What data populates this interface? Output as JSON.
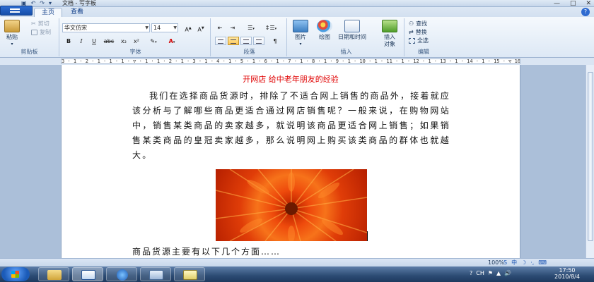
{
  "title_bar": {
    "doc_title": "文档 - 写字板",
    "controls": [
      "—",
      "□",
      "✕"
    ]
  },
  "tabs": [
    {
      "label": "主页",
      "active": true
    },
    {
      "label": "查看",
      "active": false
    }
  ],
  "ribbon": {
    "clipboard": {
      "paste_label": "粘贴",
      "cut_label": "剪切",
      "copy_label": "复制",
      "group_label": "剪贴板"
    },
    "font": {
      "font_name": "华文仿宋",
      "font_size": "14",
      "group_label": "字体",
      "bold": "B",
      "italic": "I",
      "underline": "U",
      "strike": "abc",
      "subscript": "x₂",
      "superscript": "x²"
    },
    "paragraph": {
      "group_label": "段落"
    },
    "insert": {
      "picture_label": "图片",
      "paint_label": "绘图",
      "datetime_label": "日期和时间",
      "object_label": "插入\n对象",
      "group_label": "插入"
    },
    "editing": {
      "find_label": "查找",
      "replace_label": "替换",
      "select_all_label": "全选",
      "group_label": "编辑"
    }
  },
  "ruler": "3 · 1 · 2 · 1 · 1 · 1 · ▽ · 1 · 1 · 2 · 1 · 3 · 1 · 4 · 1 · 5 · 1 · 6 · 1 · 7 · 1 · 8 · 1 · 9 · 1 · 10 · 1 · 11 · 1 · 12 · 1 · 13 · 1 · 14 · 1 · 15 · ▽ 16 · 1 · 17 · 1 ·",
  "document": {
    "heading": "开网店  给中老年朋友的经验",
    "paragraph": "我们在选择商品货源时，排除了不适合网上销售的商品外，接着就应该分析与了解哪些商品更适合通过网店销售呢？一般来说，在购物网站中，销售某类商品的卖家越多，就说明该商品更适合网上销售；如果销售某类商品的皇冠卖家越多，那么说明网上购买该类商品的群体也就越大。",
    "last_line": "商品货源主要有以下几个方面……",
    "image_alt": "orange chrysanthemum flower"
  },
  "status_bar": {
    "zoom": "100%",
    "ime_items": [
      "S",
      "中",
      "☽",
      "·,",
      "⌨"
    ]
  },
  "taskbar": {
    "tray": [
      "?",
      "CH",
      "⚑",
      "▲",
      "🔊"
    ],
    "time": "17:50",
    "date": "2010/8/4"
  }
}
